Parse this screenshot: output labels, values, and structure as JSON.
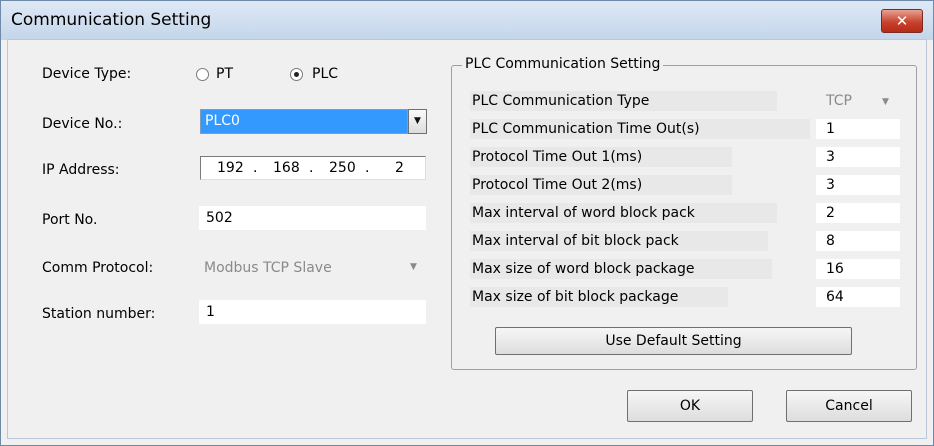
{
  "window": {
    "title": "Communication Setting",
    "close_glyph": "✕"
  },
  "left": {
    "device_type_label": "Device Type:",
    "radio_pt": "PT",
    "radio_plc": "PLC",
    "device_no_label": "Device No.:",
    "device_no_value": "PLC0",
    "ip_label": "IP Address:",
    "ip": [
      "192",
      "168",
      "250",
      "2"
    ],
    "port_label": "Port No.",
    "port_value": "502",
    "protocol_label": "Comm Protocol:",
    "protocol_value": "Modbus TCP Slave",
    "station_label": "Station number:",
    "station_value": "1"
  },
  "plc_group": {
    "legend": "PLC Communication Setting",
    "rows": [
      {
        "label": "PLC Communication Type",
        "value": "TCP"
      },
      {
        "label": "PLC Communication Time Out(s)",
        "value": "1"
      },
      {
        "label": "Protocol Time Out 1(ms)",
        "value": "3"
      },
      {
        "label": "Protocol Time Out 2(ms)",
        "value": "3"
      },
      {
        "label": "Max interval of word block pack",
        "value": "2"
      },
      {
        "label": "Max interval of bit block pack",
        "value": "8"
      },
      {
        "label": "Max size of word block package",
        "value": "16"
      },
      {
        "label": "Max size of bit block package",
        "value": "64"
      }
    ],
    "default_button": "Use Default Setting"
  },
  "buttons": {
    "ok": "OK",
    "cancel": "Cancel"
  },
  "icons": {
    "dropdown": "dropdown-arrow-icon",
    "close": "close-icon"
  }
}
